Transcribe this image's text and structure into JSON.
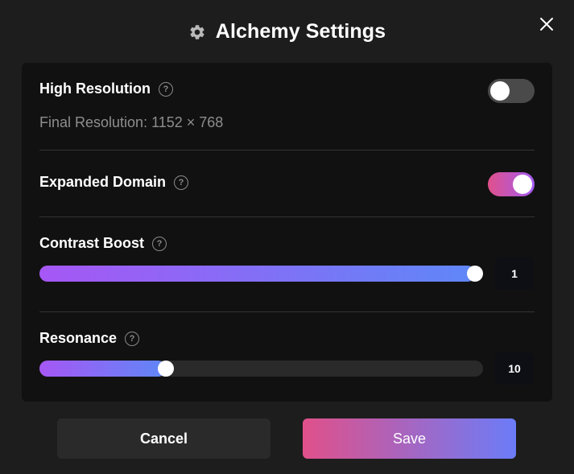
{
  "dialog": {
    "title": "Alchemy Settings",
    "icon": "gear-icon",
    "close_icon": "close-icon"
  },
  "settings": {
    "high_resolution": {
      "label": "High Resolution",
      "help": "?",
      "enabled": false,
      "final_resolution_text": "Final Resolution: 1152 × 768"
    },
    "expanded_domain": {
      "label": "Expanded Domain",
      "help": "?",
      "enabled": true
    },
    "contrast_boost": {
      "label": "Contrast Boost",
      "help": "?",
      "value": "1",
      "level": 1.0
    },
    "resonance": {
      "label": "Resonance",
      "help": "?",
      "value": "10",
      "level": 0.285
    }
  },
  "buttons": {
    "cancel": "Cancel",
    "save": "Save"
  },
  "colors": {
    "background": "#1d1d1d",
    "panel": "#111111",
    "accent_pink": "#e0508a",
    "accent_purple": "#a657f5",
    "accent_blue": "#5f87f7"
  }
}
